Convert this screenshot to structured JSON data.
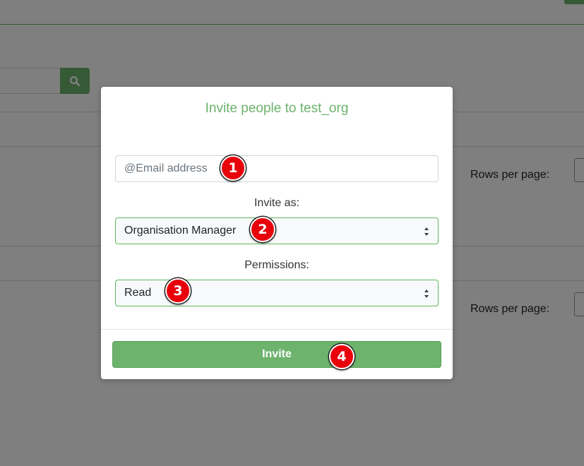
{
  "modal": {
    "title": "Invite people to test_org",
    "email": {
      "placeholder": "@Email address",
      "value": ""
    },
    "invite_as": {
      "label": "Invite as:",
      "selected": "Organisation Manager"
    },
    "permissions": {
      "label": "Permissions:",
      "selected": "Read"
    },
    "invite_button": "Invite"
  },
  "background": {
    "rows_per_page_label_1": "Rows per page:",
    "rows_per_page_label_2": "Rows per page:"
  },
  "steps": [
    "1",
    "2",
    "3",
    "4"
  ],
  "colors": {
    "accent_green": "#6db36d",
    "marker_red": "#e8000b",
    "overlay": "rgba(0,0,0,0.5)"
  },
  "icons": {
    "search": "search-icon",
    "select_arrows": "select-arrows-icon"
  }
}
